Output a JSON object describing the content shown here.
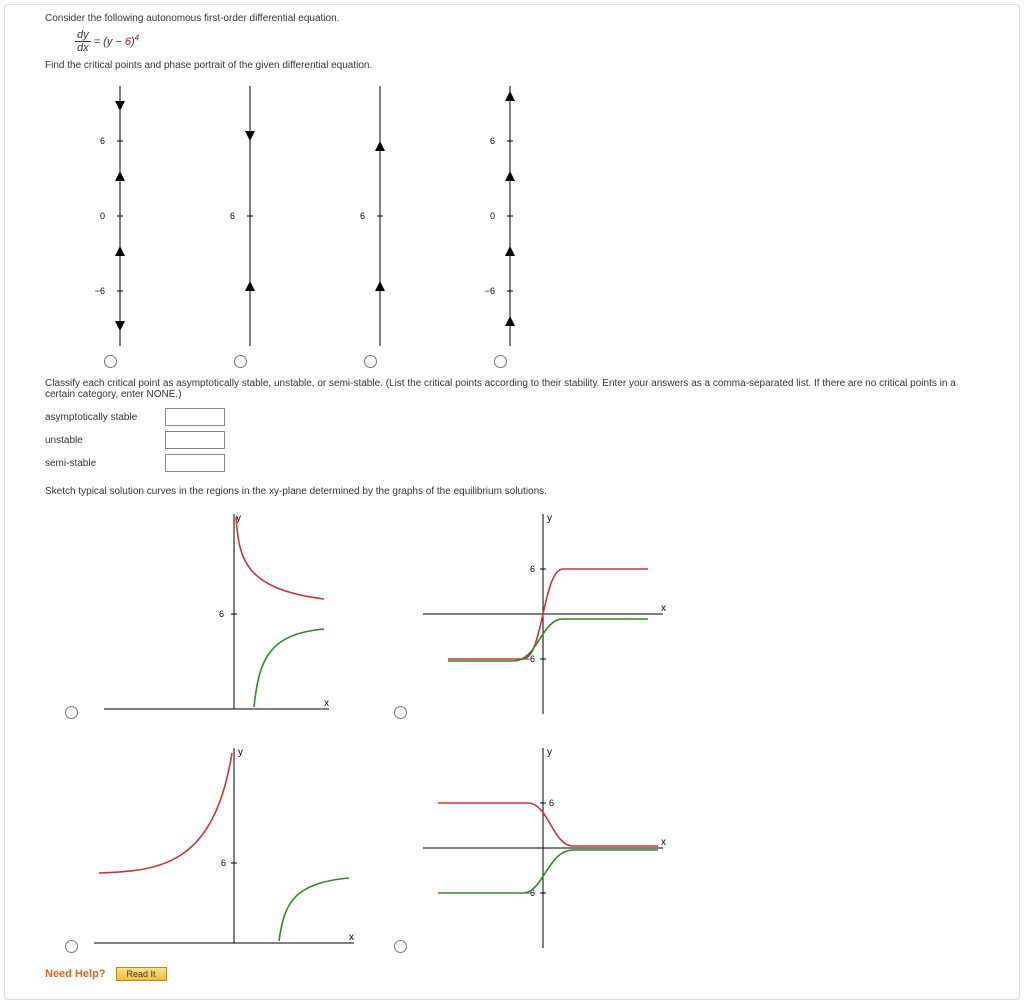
{
  "problem": {
    "intro": "Consider the following autonomous first-order differential equation.",
    "eq_lhs_num": "dy",
    "eq_lhs_den": "dx",
    "eq_rhs_prefix": " = (y − ",
    "eq_rhs_red": "6",
    "eq_rhs_suffix": ")",
    "eq_exp": "4",
    "critical_prompt": "Find the critical points and phase portrait of the given differential equation."
  },
  "phase_labels": {
    "six": "6",
    "zero": "0",
    "neg_six": "−6"
  },
  "classify": {
    "prompt": "Classify each critical point as asymptotically stable, unstable, or semi-stable. (List the critical points according to their stability. Enter your answers as a comma-separated list. If there are no critical points in a certain category, enter NONE.)",
    "rows": [
      {
        "label": "asymptotically stable"
      },
      {
        "label": "unstable"
      },
      {
        "label": "semi-stable"
      }
    ]
  },
  "sketch_prompt": "Sketch typical solution curves in the regions in the xy-plane determined by the graphs of the equilibrium solutions.",
  "axis": {
    "x": "x",
    "y": "y",
    "six": "6",
    "neg_six": "−6"
  },
  "help": {
    "label": "Need Help?",
    "read_it": "Read It"
  },
  "chart_data": [
    {
      "id": "phase-1",
      "type": "phase-line",
      "axis_ticks": [
        6,
        0,
        -6
      ],
      "arrows": [
        {
          "segment": "above 6",
          "direction": "down"
        },
        {
          "segment": "0 to 6",
          "direction": "up"
        },
        {
          "segment": "-6 to 0",
          "direction": "up"
        },
        {
          "segment": "below -6",
          "direction": "down"
        }
      ]
    },
    {
      "id": "phase-2",
      "type": "phase-line",
      "axis_ticks": [
        6
      ],
      "arrows": [
        {
          "segment": "above 6",
          "direction": "down"
        },
        {
          "segment": "below 6",
          "direction": "up"
        }
      ]
    },
    {
      "id": "phase-3",
      "type": "phase-line",
      "axis_ticks": [
        6
      ],
      "arrows": [
        {
          "segment": "above 6",
          "direction": "up"
        },
        {
          "segment": "below 6",
          "direction": "up"
        }
      ]
    },
    {
      "id": "phase-4",
      "type": "phase-line",
      "axis_ticks": [
        6,
        0,
        -6
      ],
      "arrows": [
        {
          "segment": "above 6",
          "direction": "up"
        },
        {
          "segment": "0 to 6",
          "direction": "up"
        },
        {
          "segment": "-6 to 0",
          "direction": "up"
        },
        {
          "segment": "below -6",
          "direction": "up"
        }
      ]
    },
    {
      "id": "curve-A",
      "type": "solution-curves",
      "x_range": [
        0,
        10
      ],
      "y_range": [
        0,
        12
      ],
      "equilibrium_y": [
        6
      ],
      "curves": [
        {
          "color": "red",
          "description": "starts high left, decreases toward y=6 from above"
        },
        {
          "color": "green",
          "description": "starts low,  increases toward y=6 from below"
        }
      ]
    },
    {
      "id": "curve-B",
      "type": "solution-curves",
      "x_range": [
        -10,
        10
      ],
      "y_range": [
        -10,
        10
      ],
      "equilibrium_y": [
        6,
        -6
      ],
      "curves": [
        {
          "color": "red",
          "description": "S-curve rising from y=-6 to y=6 through origin"
        },
        {
          "color": "green",
          "description": "curve rising from below y=-6 to just under y=0, leveling right"
        }
      ]
    },
    {
      "id": "curve-C",
      "type": "solution-curves",
      "x_range": [
        -10,
        10
      ],
      "y_range": [
        0,
        12
      ],
      "equilibrium_y": [
        6
      ],
      "curves": [
        {
          "color": "red",
          "description": "from far left approaches y=6 from below, blows up near x=0"
        },
        {
          "color": "green",
          "description": "starts near 0 at x>0, rises toward y=6"
        }
      ]
    },
    {
      "id": "curve-D",
      "type": "solution-curves",
      "x_range": [
        -10,
        10
      ],
      "y_range": [
        -10,
        10
      ],
      "equilibrium_y": [
        6,
        -6
      ],
      "curves": [
        {
          "color": "red",
          "description": "from y=6 at left decreases toward y=0 on right"
        },
        {
          "color": "green",
          "description": "from below y=-6 on left rises to approach y=-6 then levels near 0 on right"
        }
      ]
    }
  ]
}
